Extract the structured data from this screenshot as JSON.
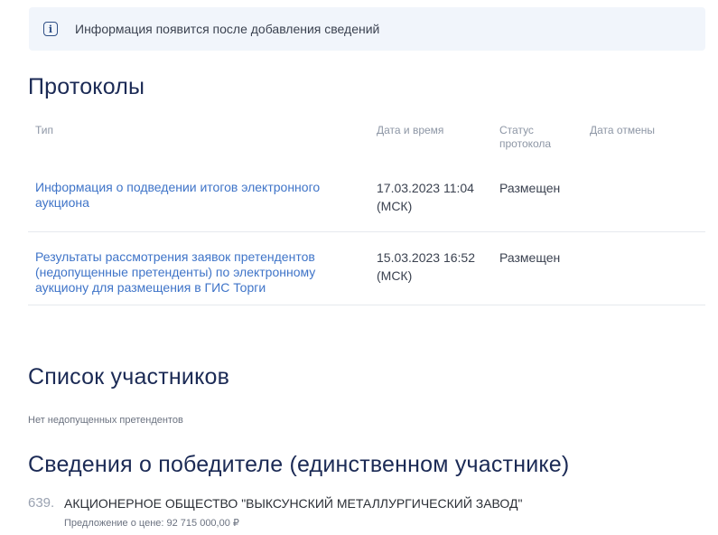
{
  "info": {
    "text": "Информация появится после добавления сведений",
    "icon": "info-icon"
  },
  "protocols": {
    "title": "Протоколы",
    "columns": {
      "type": "Тип",
      "datetime": "Дата и время",
      "status_line1": "Статус",
      "status_line2": "протокола",
      "cancel_date": "Дата отмены"
    },
    "rows": [
      {
        "type_line1": "Информация о подведении итогов электронного",
        "type_line2": "аукциона",
        "type_line3": "",
        "date": "17.03.2023 11:04",
        "tz": "(МСК)",
        "status": "Размещен",
        "cancel_date": ""
      },
      {
        "type_line1": "Результаты рассмотрения заявок претендентов",
        "type_line2": "(недопущенные претенденты) по электронному",
        "type_line3": "аукциону для размещения в ГИС Торги",
        "date": "15.03.2023 16:52",
        "tz": "(МСК)",
        "status": "Размещен",
        "cancel_date": ""
      }
    ]
  },
  "participants": {
    "title": "Список участников",
    "note": "Нет недопущенных претендентов"
  },
  "winner": {
    "title": "Сведения о победителе (единственном участнике)",
    "number": "639.",
    "name": "АКЦИОНЕРНОЕ ОБЩЕСТВО \"ВЫКСУНСКИЙ МЕТАЛЛУРГИЧЕСКИЙ ЗАВОД\"",
    "offer": "Предложение о цене: 92 715 000,00 ₽"
  }
}
